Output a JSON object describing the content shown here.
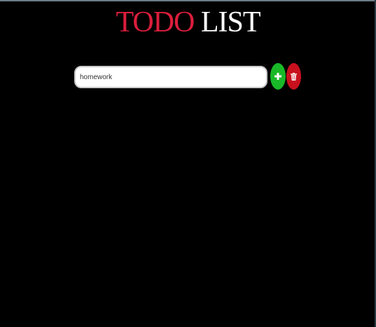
{
  "header": {
    "title_part1": "TODO",
    "title_part2": "LIST"
  },
  "todo_form": {
    "input_value": "homework",
    "add_icon": "plus-icon",
    "delete_icon": "trash-icon"
  },
  "colors": {
    "background": "#000000",
    "title_accent": "#dc1e3c",
    "title_text": "#ffffff",
    "add_button": "#19b828",
    "delete_button": "#c8101e"
  }
}
